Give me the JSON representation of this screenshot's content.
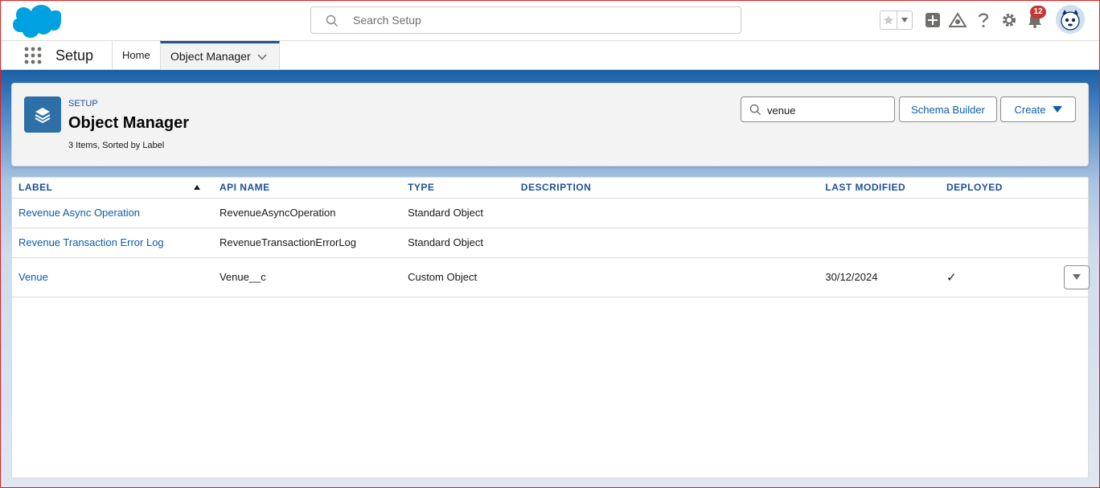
{
  "header": {
    "search_placeholder": "Search Setup",
    "notification_count": "12"
  },
  "context_bar": {
    "app_name": "Setup",
    "home_label": "Home",
    "active_tab_label": "Object Manager"
  },
  "page_header": {
    "eyebrow": "SETUP",
    "title": "Object Manager",
    "meta": "3 Items, Sorted by Label",
    "quick_find_value": "venue",
    "schema_builder_label": "Schema Builder",
    "create_label": "Create"
  },
  "table": {
    "columns": [
      "LABEL",
      "API NAME",
      "TYPE",
      "DESCRIPTION",
      "LAST MODIFIED",
      "DEPLOYED"
    ],
    "rows": [
      {
        "label": "Revenue Async Operation",
        "api_name": "RevenueAsyncOperation",
        "type": "Standard Object",
        "description": "",
        "last_modified": "",
        "deployed": ""
      },
      {
        "label": "Revenue Transaction Error Log",
        "api_name": "RevenueTransactionErrorLog",
        "type": "Standard Object",
        "description": "",
        "last_modified": "",
        "deployed": ""
      },
      {
        "label": "Venue",
        "api_name": "Venue__c",
        "type": "Custom Object",
        "description": "",
        "last_modified": "30/12/2024",
        "deployed": "✓"
      }
    ]
  },
  "colors": {
    "brand_blue": "#1b5297",
    "link_blue": "#0b5cab",
    "object_icon_bg": "#2e6fa7",
    "badge_red": "#c23934",
    "salesforce_cloud": "#00a1e0"
  },
  "icons": {
    "logo": "salesforce-cloud-logo",
    "search": "search-icon",
    "favorites": "star-icon",
    "add": "plus-icon",
    "trailhead": "trailhead-icon",
    "help": "question-icon",
    "setup": "gear-icon",
    "notifications": "bell-icon",
    "avatar": "astro-avatar",
    "app_launcher": "waffle-icon",
    "object_manager": "layers-icon"
  }
}
